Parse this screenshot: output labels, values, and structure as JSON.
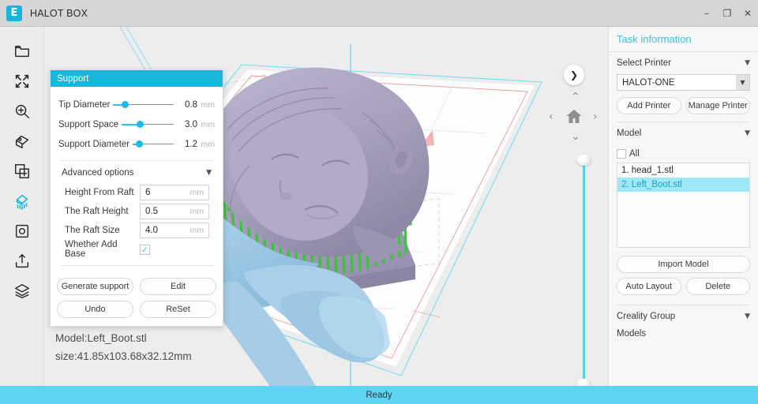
{
  "titlebar": {
    "logo_glyph": "E",
    "title": "HALOT BOX",
    "minimize": "–",
    "maximize": "❐",
    "close": "✕"
  },
  "toolbar": {
    "items": [
      {
        "icon": "open-folder-icon",
        "active": false
      },
      {
        "icon": "move-arrows-icon",
        "active": false
      },
      {
        "icon": "zoom-scale-icon",
        "active": false
      },
      {
        "icon": "rotate-icon",
        "active": false
      },
      {
        "icon": "duplicate-icon",
        "active": false
      },
      {
        "icon": "support-icon",
        "active": true
      },
      {
        "icon": "hollow-icon",
        "active": false
      },
      {
        "icon": "export-icon",
        "active": false
      },
      {
        "icon": "layers-icon",
        "active": false
      }
    ]
  },
  "support_panel": {
    "header": "Support",
    "sliders": [
      {
        "label": "Tip Diameter",
        "value": "0.8",
        "unit": "mm",
        "pct": 18
      },
      {
        "label": "Support Space",
        "value": "3.0",
        "unit": "mm",
        "pct": 32
      },
      {
        "label": "Support Diameter",
        "value": "1.2",
        "unit": "mm",
        "pct": 10
      }
    ],
    "advanced_label": "Advanced options",
    "advanced_caret": "▼",
    "fields": [
      {
        "label": "Height From Raft",
        "value": "6",
        "unit": "mm"
      },
      {
        "label": "The Raft Height",
        "value": "0.5",
        "unit": "mm"
      },
      {
        "label": "The Raft Size",
        "value": "4.0",
        "unit": "mm"
      }
    ],
    "checkbox": {
      "label": "Whether Add Base",
      "checked": true,
      "glyph": "✓"
    },
    "buttons": {
      "generate_support": "Generate support",
      "edit": "Edit",
      "undo": "Undo",
      "reset": "ReSet"
    }
  },
  "viewport": {
    "model_name_line": "Model:Left_Boot.stl",
    "model_size_line": "size:41.85x103.68x32.12mm",
    "expand_icon": "❯",
    "nav": {
      "up": "⌃",
      "down": "⌄",
      "left": "‹",
      "right": "›",
      "home_icon": "home-icon"
    },
    "colors": {
      "model": "#a9a2bd",
      "support": "#3fc23f",
      "second_model": "#a5cfe8",
      "plate_grid": "#69dced",
      "axis_red": "#f09a9a",
      "background": "#ededed"
    }
  },
  "sidebar": {
    "title": "Task information",
    "printer_section": {
      "head": "Select Printer",
      "caret": "▼",
      "selected": "HALOT-ONE",
      "select_arrow": "▼",
      "add_printer": "Add Printer",
      "manage_printer": "Manage Printer"
    },
    "model_section": {
      "head": "Model",
      "caret": "▼",
      "all_label": "All",
      "all_checked": false,
      "items": [
        {
          "label": "1. head_1.stl",
          "selected": false
        },
        {
          "label": "2. Left_Boot.stl",
          "selected": true
        }
      ],
      "import_model": "Import Model",
      "auto_layout": "Auto Layout",
      "delete": "Delete"
    },
    "group_section": {
      "head": "Creality Group",
      "caret": "▼",
      "models_label": "Models"
    }
  },
  "statusbar": {
    "text": "Ready"
  }
}
